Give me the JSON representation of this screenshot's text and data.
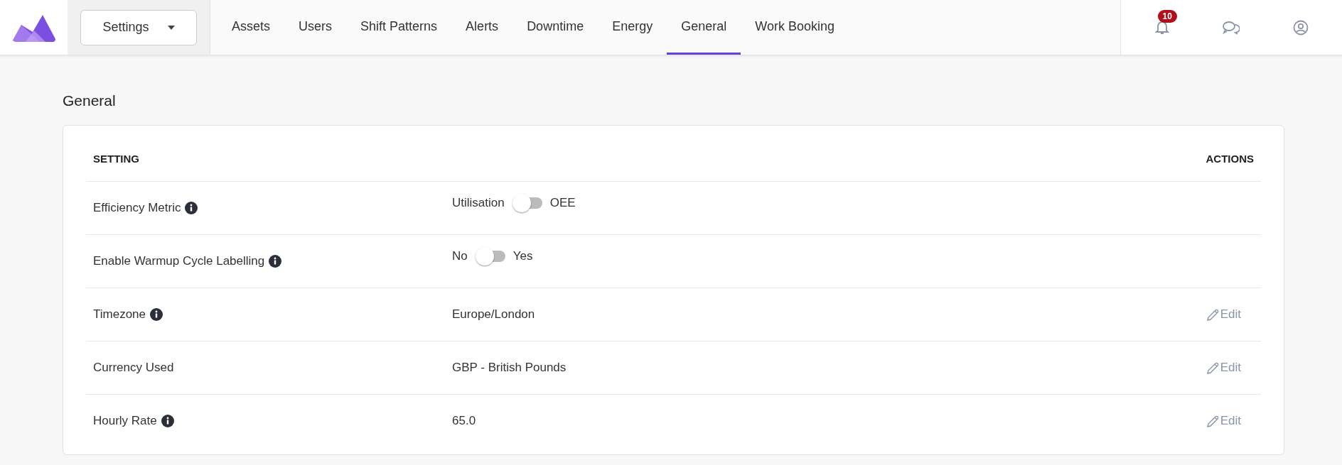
{
  "menu": {
    "label": "Settings"
  },
  "tabs": [
    {
      "label": "Assets",
      "selected": false
    },
    {
      "label": "Users",
      "selected": false
    },
    {
      "label": "Shift Patterns",
      "selected": false
    },
    {
      "label": "Alerts",
      "selected": false
    },
    {
      "label": "Downtime",
      "selected": false
    },
    {
      "label": "Energy",
      "selected": false
    },
    {
      "label": "General",
      "selected": true
    },
    {
      "label": "Work Booking",
      "selected": false
    }
  ],
  "notifications": {
    "count": "10"
  },
  "page_title": "General",
  "table": {
    "columns": [
      "SETTING",
      "ACTIONS"
    ],
    "rows": [
      {
        "name": "Efficiency Metric",
        "info": true,
        "kind": "toggle",
        "off_label": "Utilisation",
        "on_label": "OEE",
        "on": false
      },
      {
        "name": "Enable Warmup Cycle Labelling",
        "info": true,
        "kind": "toggle",
        "off_label": "No",
        "on_label": "Yes",
        "on": false
      },
      {
        "name": "Timezone",
        "info": true,
        "kind": "value",
        "value": "Europe/London",
        "action": "Edit"
      },
      {
        "name": "Currency Used",
        "info": false,
        "kind": "value",
        "value": "GBP - British Pounds",
        "action": "Edit"
      },
      {
        "name": "Hourly Rate",
        "info": true,
        "kind": "value",
        "value": "65.0",
        "action": "Edit"
      }
    ]
  }
}
